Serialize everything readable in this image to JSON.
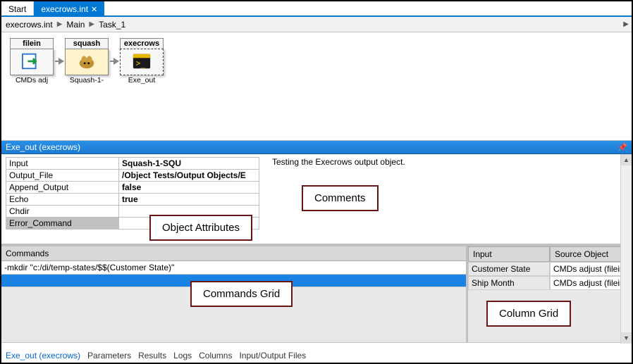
{
  "tabs": {
    "start": "Start",
    "active": "execrows.int"
  },
  "breadcrumb": {
    "a": "execrows.int",
    "b": "Main",
    "c": "Task_1"
  },
  "nodes": {
    "filein": {
      "title": "filein",
      "label": "CMDs adj"
    },
    "squash": {
      "title": "squash",
      "label": "Squash-1-"
    },
    "execrows": {
      "title": "execrows",
      "label": "Exe_out"
    }
  },
  "detail_header": "Exe_out (execrows)",
  "attributes": [
    {
      "key": "Input",
      "val": "Squash-1-SQU"
    },
    {
      "key": "Output_File",
      "val": "/Object Tests/Output Objects/E"
    },
    {
      "key": "Append_Output",
      "val": "false"
    },
    {
      "key": "Echo",
      "val": "true"
    },
    {
      "key": "Chdir",
      "val": ""
    },
    {
      "key": "Error_Command",
      "val": ""
    }
  ],
  "comments": "Testing the Execrows output object.",
  "commands_header": "Commands",
  "commands": [
    "-mkdir \"c:/di/temp-states/$$(Customer State)\""
  ],
  "columns_headers": {
    "input": "Input",
    "source": "Source Object"
  },
  "columns": [
    {
      "input": "Customer State",
      "source": "CMDs adjust (filein)"
    },
    {
      "input": "Ship Month",
      "source": "CMDs adjust (filein)"
    }
  ],
  "callouts": {
    "object_attributes": "Object Attributes",
    "comments": "Comments",
    "commands_grid": "Commands Grid",
    "column_grid": "Column Grid"
  },
  "footer_tabs": {
    "exe": "Exe_out (execrows)",
    "parameters": "Parameters",
    "results": "Results",
    "logs": "Logs",
    "columns": "Columns",
    "io": "Input/Output Files"
  }
}
